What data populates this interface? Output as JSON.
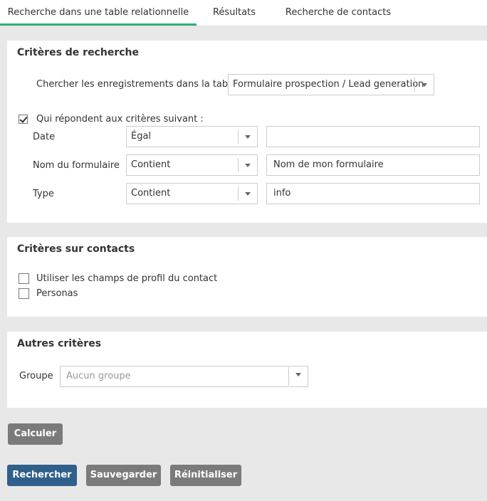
{
  "tabs": [
    "Recherche dans une table relationnelle",
    "Résultats",
    "Recherche de contacts"
  ],
  "search_criteria": {
    "title": "Critères de recherche",
    "table_label": "Chercher les enregistrements dans la table :",
    "table_value": "Formulaire prospection / Lead generation",
    "matching_label": "Qui répondent aux critères suivant :",
    "matching_checked": true,
    "rows": [
      {
        "field": "Date",
        "operator": "Égal",
        "value": ""
      },
      {
        "field": "Nom du formulaire",
        "operator": "Contient",
        "value": "Nom de mon formulaire"
      },
      {
        "field": "Type",
        "operator": "Contient",
        "value": "info"
      }
    ]
  },
  "contact_criteria": {
    "title": "Critères sur contacts",
    "options": [
      {
        "label": "Utiliser les champs de profil du contact",
        "checked": false
      },
      {
        "label": "Personas",
        "checked": false
      }
    ]
  },
  "other_criteria": {
    "title": "Autres critères",
    "group_label": "Groupe",
    "group_placeholder": "Aucun groupe"
  },
  "buttons": {
    "calculate": "Calculer",
    "search": "Rechercher",
    "save": "Sauvegarder",
    "reset": "Réinitialiser"
  },
  "colors": {
    "accent_tab": "#2bb673",
    "primary_button": "#2f5f8a",
    "secondary_button": "#7a7a7a"
  }
}
